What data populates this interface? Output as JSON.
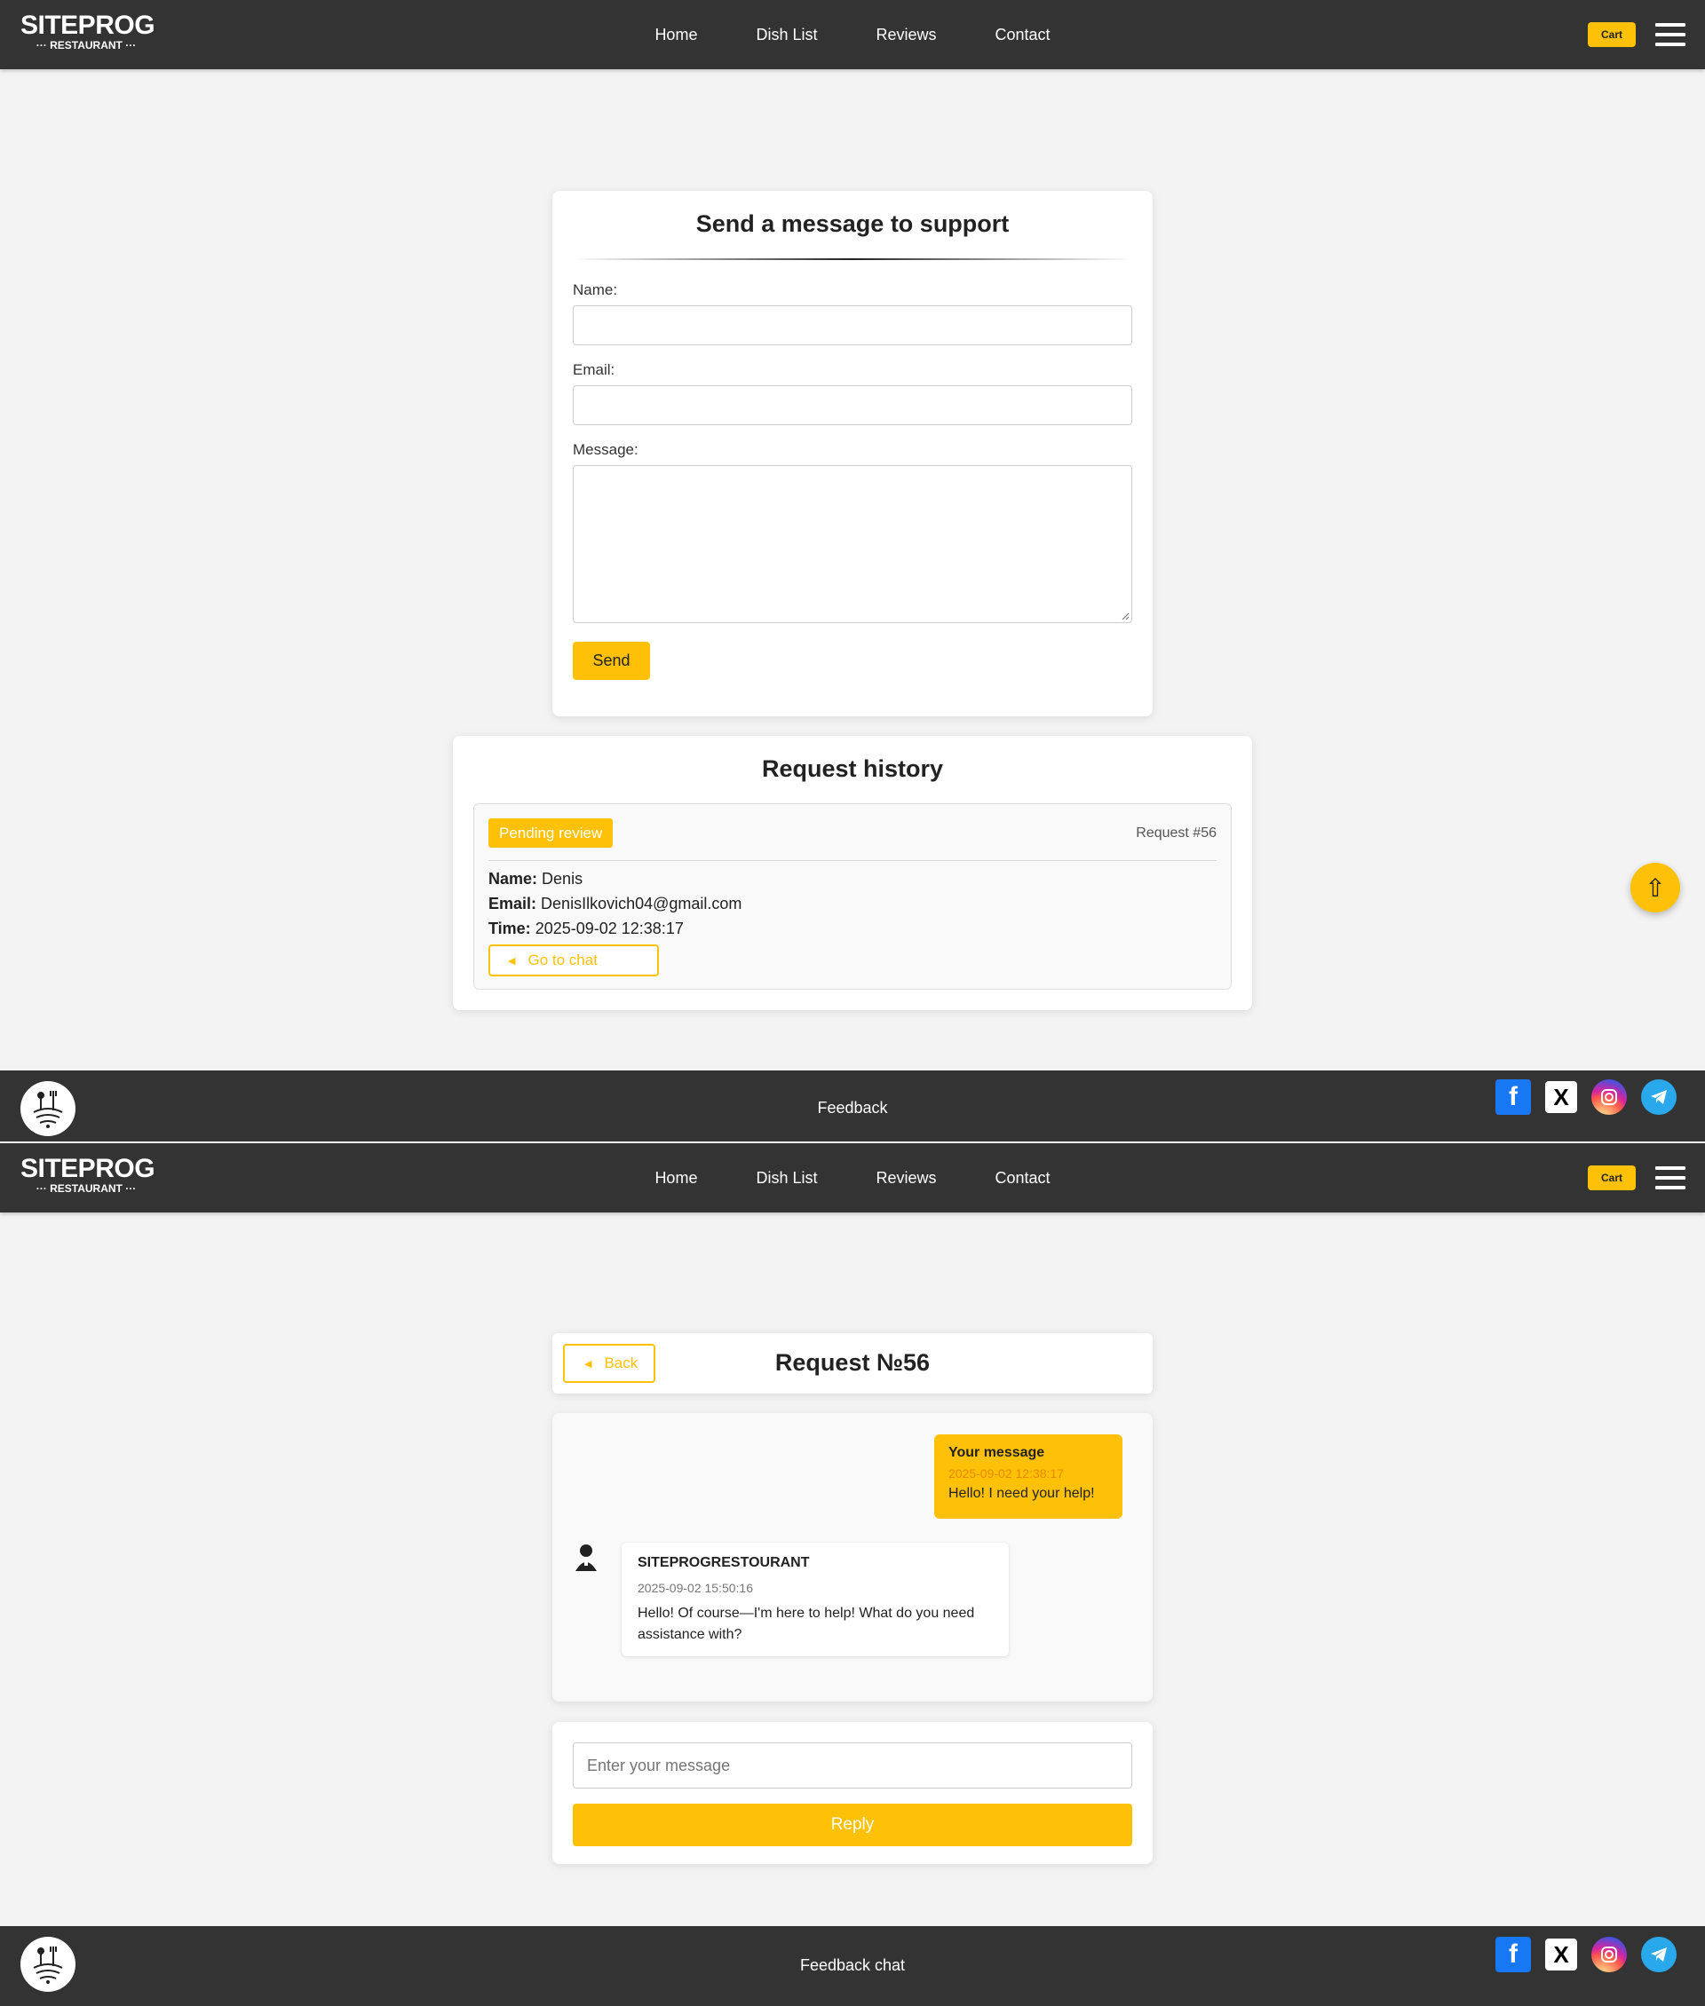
{
  "header": {
    "logo_main": "SITEPROG",
    "logo_sub": "··· RESTAURANT ···",
    "nav": [
      "Home",
      "Dish List",
      "Reviews",
      "Contact"
    ],
    "cart_label": "Cart"
  },
  "support_form": {
    "title": "Send a message to support",
    "name_label": "Name:",
    "email_label": "Email:",
    "message_label": "Message:",
    "send_label": "Send"
  },
  "history": {
    "title": "Request history",
    "status": "Pending review",
    "request_id": "Request #56",
    "name_key": "Name:",
    "name_value": "Denis",
    "email_key": "Email:",
    "email_value": "DenisIlkovich04@gmail.com",
    "time_key": "Time:",
    "time_value": "2025-09-02 12:38:17",
    "go_to_chat": "Go to chat"
  },
  "footer1": {
    "text": "Feedback"
  },
  "chat": {
    "back_label": "Back",
    "title": "Request №56",
    "user_msg": {
      "author": "Your message",
      "time": "2025-09-02 12:38:17",
      "text": "Hello! I need your help!"
    },
    "support_msg": {
      "author": "SITEPROGRESTOURANT",
      "time": "2025-09-02 15:50:16",
      "text": "Hello! Of course—I'm here to help! What do you need assistance with?"
    },
    "input_placeholder": "Enter your message",
    "reply_label": "Reply"
  },
  "footer2": {
    "text": "Feedback chat"
  },
  "colors": {
    "accent": "#ffc107",
    "dark": "#333333"
  },
  "icons": [
    "facebook-icon",
    "x-icon",
    "instagram-icon",
    "telegram-icon",
    "arrow-up-icon",
    "menu-icon"
  ]
}
